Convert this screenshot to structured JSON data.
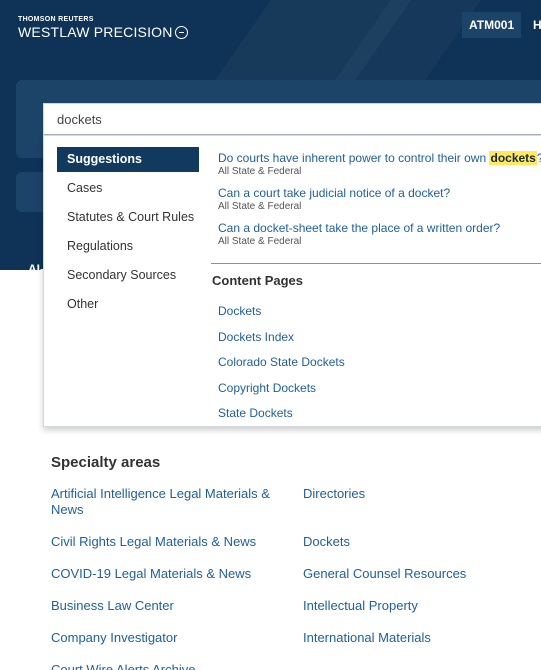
{
  "header": {
    "brand_top": "THOMSON REUTERS",
    "brand_main": "WESTLAW PRECISION",
    "client_id": "ATM001",
    "nav_partial": "H"
  },
  "ai_tab_label": "AI-",
  "search": {
    "value": "dockets"
  },
  "dropdown": {
    "categories": [
      {
        "label": "Suggestions",
        "active": true
      },
      {
        "label": "Cases"
      },
      {
        "label": "Statutes & Court Rules"
      },
      {
        "label": "Regulations"
      },
      {
        "label": "Secondary Sources"
      },
      {
        "label": "Other"
      }
    ],
    "suggestions": [
      {
        "before": "Do courts have inherent power to control their own ",
        "highlight": "dockets",
        "after": "?",
        "jurisdiction": "All State & Federal"
      },
      {
        "before": "Can a court take judicial notice of a docket?",
        "highlight": "",
        "after": "",
        "jurisdiction": "All State & Federal"
      },
      {
        "before": "Can a docket-sheet take the place of a written order?",
        "highlight": "",
        "after": "",
        "jurisdiction": "All State & Federal"
      }
    ],
    "content_heading": "Content Pages",
    "content_pages": [
      "Dockets",
      "Dockets Index",
      "Colorado State Dockets",
      "Copyright Dockets",
      "State Dockets"
    ]
  },
  "specialty": {
    "heading": "Specialty areas",
    "col1": [
      "Artificial Intelligence Legal Materials & News",
      "Civil Rights Legal Materials & News",
      "COVID-19 Legal Materials & News",
      "Business Law Center",
      "Company Investigator",
      "Court Wire Alerts Archive"
    ],
    "col2": [
      "Directories",
      "Dockets",
      "General Counsel Resources",
      "Intellectual Property",
      "International Materials"
    ]
  },
  "colors": {
    "header_bg": "#0f3356",
    "panel_bg": "#1c4368",
    "active_category_bg": "#123a5f",
    "link": "#1f5fa0",
    "highlight": "#ffe95c"
  }
}
